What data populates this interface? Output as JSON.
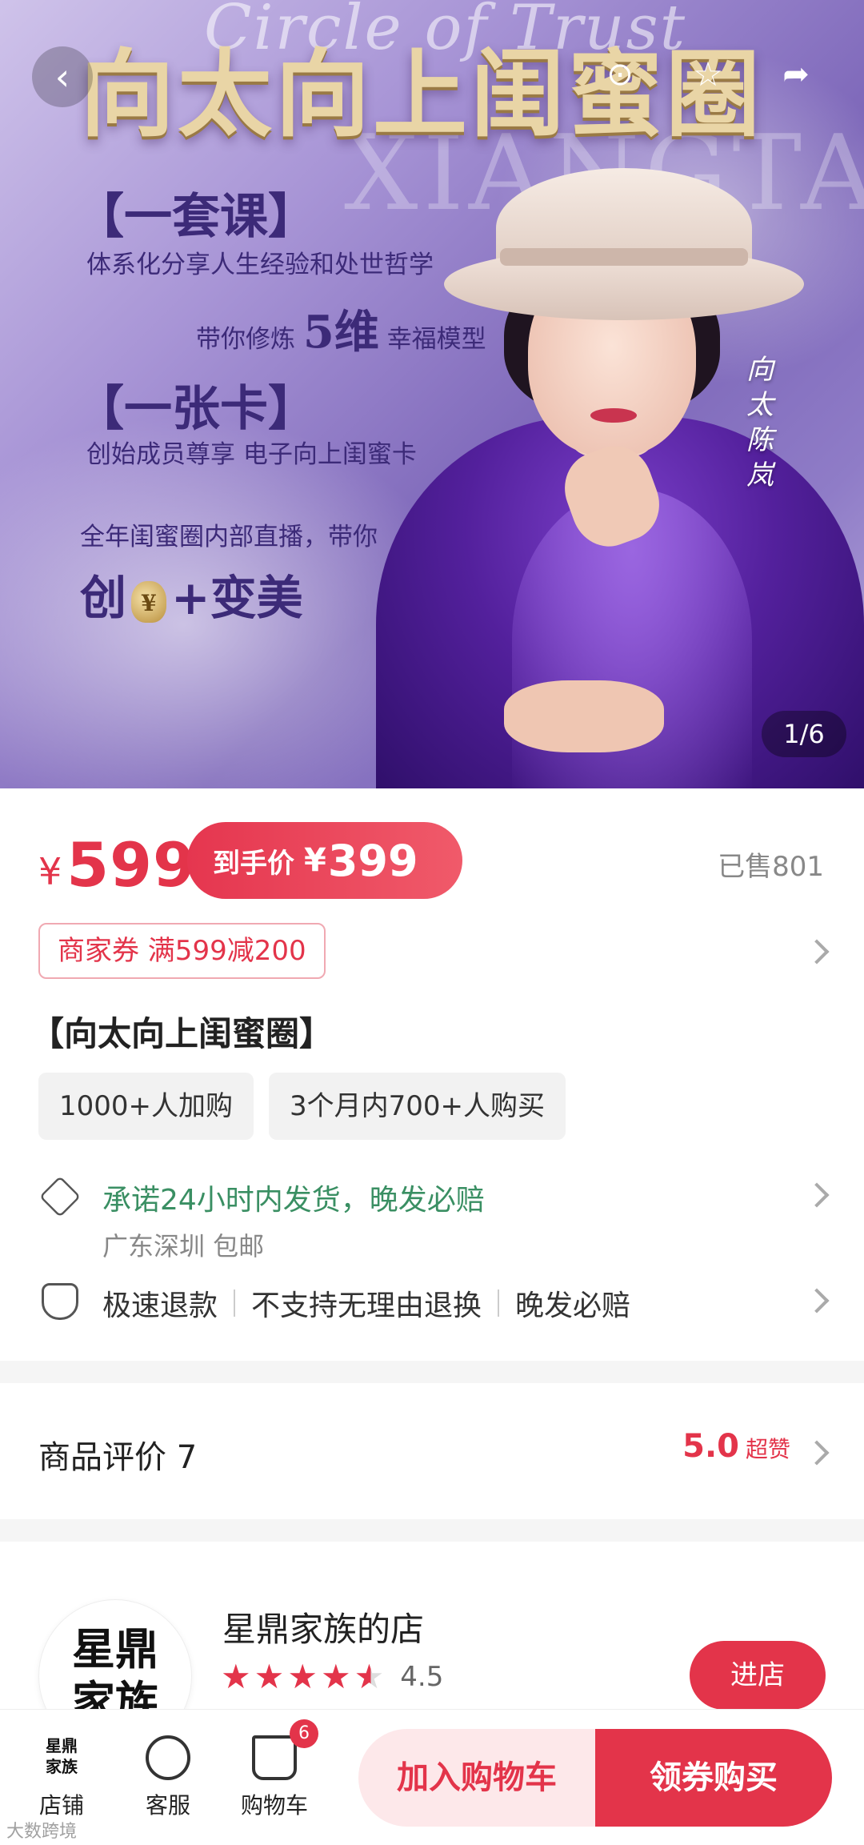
{
  "hero": {
    "title": "向太向上闺蜜圈",
    "script_text": "Circle of Trust",
    "ghost_text": "XIANGTAI",
    "course_bracket": "【一套课】",
    "course_line1": "体系化分享人生经验和处世哲学",
    "course_line2_pre": "带你修炼",
    "course_line2_num": "5维",
    "course_line2_post": "幸福模型",
    "card_bracket": "【一张卡】",
    "card_line": "创始成员尊享 电子向上闺蜜卡",
    "live_line": "全年闺蜜圈内部直播，带你",
    "big_line_pre": "创",
    "bag_glyph": "¥",
    "big_line_post": "+变美",
    "signature": "向太陈岚",
    "counter": "1/6"
  },
  "nav": {
    "back_icon": "‹",
    "service_icon": "⊙",
    "favorite_icon": "☆",
    "share_icon": "➦"
  },
  "price": {
    "currency": "¥",
    "original": "599",
    "final_label": "到手价",
    "final_currency": "¥",
    "final_value": "399",
    "sold": "已售801"
  },
  "coupon": "商家券 满599减200",
  "product": {
    "title": "【向太向上闺蜜圈】",
    "tags": [
      "1000+人加购",
      "3个月内700+人购买"
    ]
  },
  "service": {
    "shipping": "承诺24小时内发货，晚发必赔",
    "origin": "广东深圳 包邮",
    "guarantees": [
      "极速退款",
      "不支持无理由退换",
      "晚发必赔"
    ]
  },
  "reviews": {
    "title": "商品评价 7",
    "score": "5.0",
    "score_tag": "超赞"
  },
  "shop": {
    "logo_line1": "星鼎",
    "logo_line2": "家族",
    "name": "星鼎家族的店",
    "rating": "4.5",
    "enter_label": "进店"
  },
  "bottom": {
    "store_label": "店铺",
    "service_label": "客服",
    "cart_label": "购物车",
    "cart_count": "6",
    "add_cart_label": "加入购物车",
    "buy_label": "领券购买"
  },
  "watermark": "大数跨境",
  "colors": {
    "accent": "#e3344a",
    "success": "#3a8f63",
    "hero_purple": "#3c2a78"
  }
}
